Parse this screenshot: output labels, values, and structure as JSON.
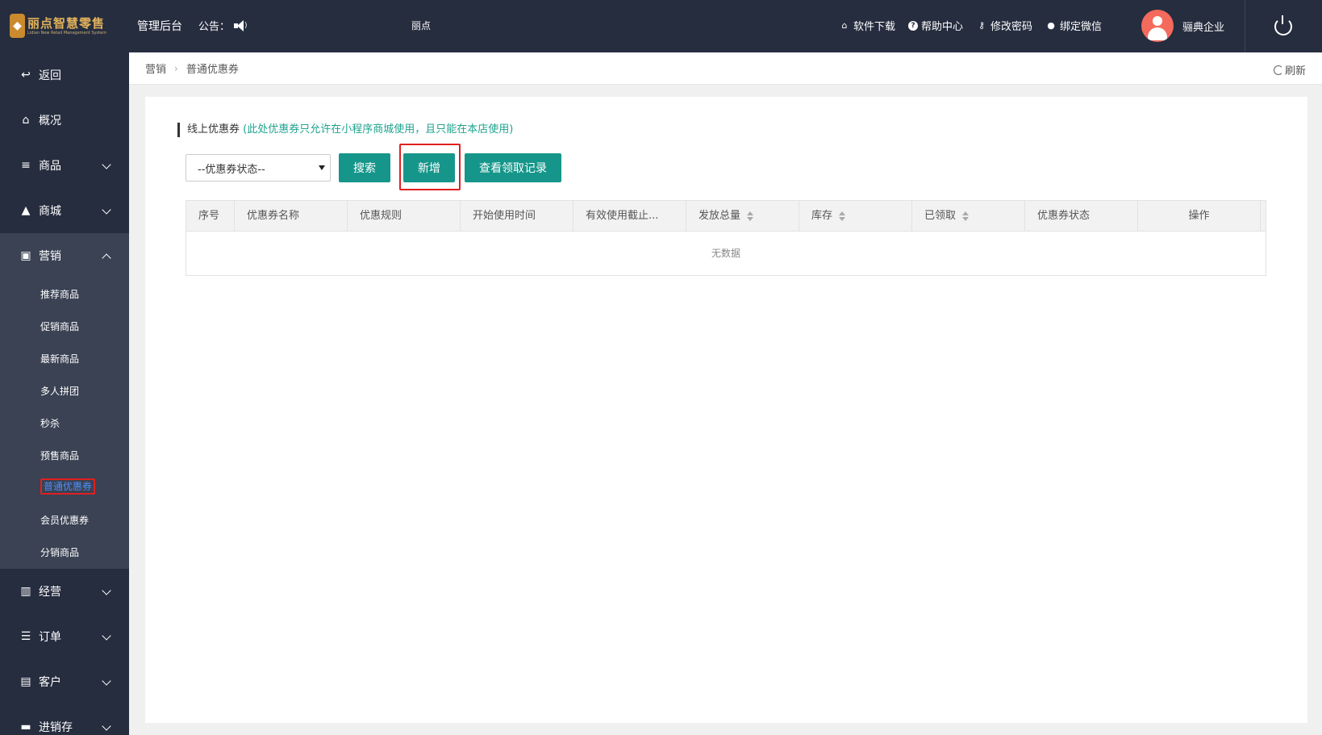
{
  "header": {
    "logo_title": "丽点智慧零售",
    "logo_subtitle": "Lidian New Retail Management System",
    "admin_label": "管理后台",
    "notice_label": "公告：",
    "store_label": "丽点",
    "links": [
      {
        "icon": "store-icon",
        "label": "软件下载"
      },
      {
        "icon": "help-icon",
        "label": "帮助中心"
      },
      {
        "icon": "key-icon",
        "label": "修改密码"
      },
      {
        "icon": "wechat-icon",
        "label": "绑定微信"
      }
    ],
    "user_name": "骊典企业"
  },
  "sidebar": {
    "items": [
      {
        "label": "返回",
        "icon": "back-icon"
      },
      {
        "label": "概况",
        "icon": "home-icon"
      },
      {
        "label": "商品",
        "icon": "list-icon"
      },
      {
        "label": "商城",
        "icon": "shop-icon"
      },
      {
        "label": "营销",
        "icon": "gift-icon"
      },
      {
        "label": "经营",
        "icon": "bar-chart-icon"
      },
      {
        "label": "订单",
        "icon": "list-icon"
      },
      {
        "label": "客户",
        "icon": "id-card-icon"
      },
      {
        "label": "进销存",
        "icon": "truck-icon"
      }
    ],
    "marketing_subitems": [
      "推荐商品",
      "促销商品",
      "最新商品",
      "多人拼团",
      "秒杀",
      "预售商品",
      "普通优惠券",
      "会员优惠券",
      "分销商品"
    ]
  },
  "breadcrumb": {
    "parent": "营销",
    "current": "普通优惠券",
    "refresh_label": "刷新"
  },
  "main": {
    "section_title": "线上优惠券",
    "section_note": "(此处优惠券只允许在小程序商城使用，且只能在本店使用)",
    "status_select": "--优惠券状态--",
    "search_button": "搜索",
    "add_button": "新增",
    "records_button": "查看领取记录",
    "table": {
      "columns": [
        "序号",
        "优惠券名称",
        "优惠规则",
        "开始使用时间",
        "有效使用截止...",
        "发放总量",
        "库存",
        "已领取",
        "优惠券状态",
        "操作"
      ],
      "empty_text": "无数据"
    }
  }
}
